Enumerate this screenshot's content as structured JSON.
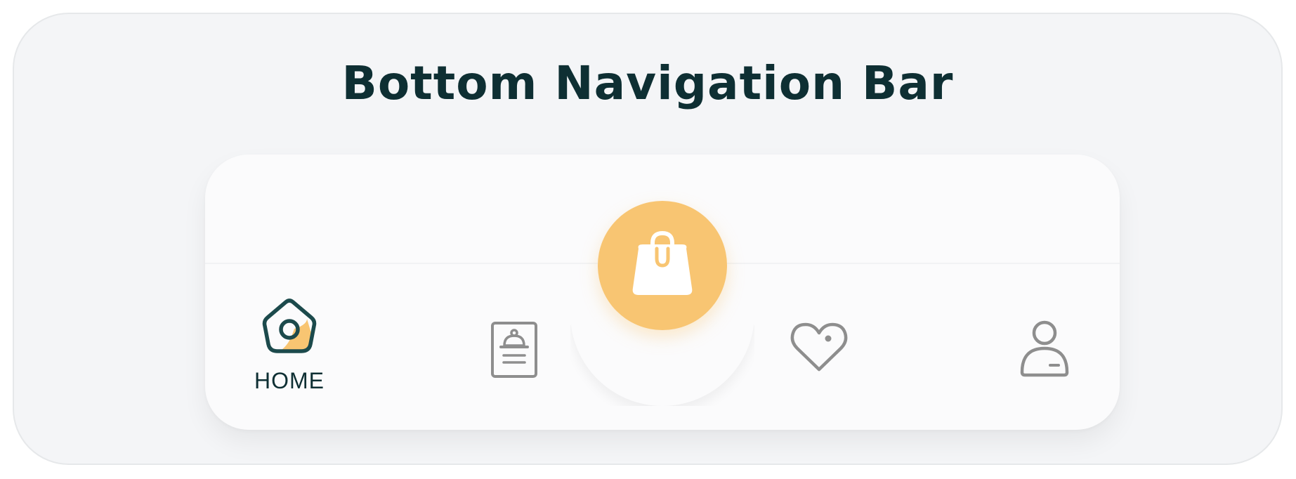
{
  "page": {
    "title": "Bottom Navigation Bar"
  },
  "colors": {
    "accent": "#f8c572",
    "active": "#1c4a4c",
    "inactive": "#8e8e8e",
    "title": "#0e2f33"
  },
  "nav": {
    "items": [
      {
        "id": "home",
        "icon": "home-icon",
        "label": "HOME",
        "active": true
      },
      {
        "id": "menu",
        "icon": "menu-document-icon",
        "label": "",
        "active": false
      },
      {
        "id": "cart",
        "icon": "shopping-bag-icon",
        "label": "",
        "active": false
      },
      {
        "id": "favorites",
        "icon": "heart-icon",
        "label": "",
        "active": false
      },
      {
        "id": "profile",
        "icon": "user-icon",
        "label": "",
        "active": false
      }
    ]
  }
}
